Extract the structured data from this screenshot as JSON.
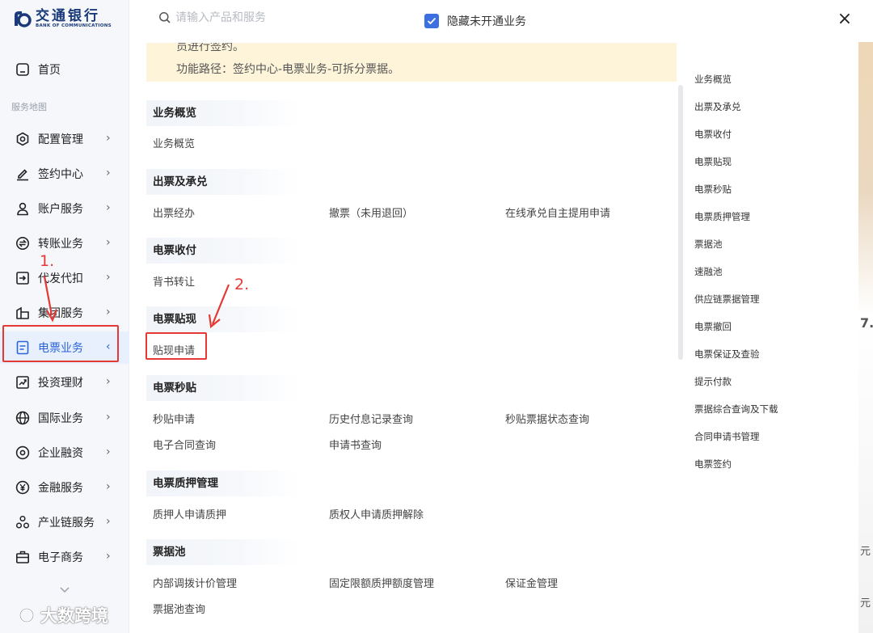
{
  "logo": {
    "cn": "交通银行",
    "en": "BANK OF COMMUNICATIONS"
  },
  "search": {
    "placeholder": "请输入产品和服务"
  },
  "hide_unopened": {
    "label": "隐藏未开通业务",
    "checked": true
  },
  "close_icon": "×",
  "sidebar": {
    "home": "首页",
    "section_label": "服务地图",
    "items": [
      {
        "label": "配置管理",
        "icon": "gear-icon"
      },
      {
        "label": "签约中心",
        "icon": "pen-icon"
      },
      {
        "label": "账户服务",
        "icon": "user-icon"
      },
      {
        "label": "转账业务",
        "icon": "transfer-icon"
      },
      {
        "label": "代发代扣",
        "icon": "export-icon"
      },
      {
        "label": "集团服务",
        "icon": "building-icon"
      },
      {
        "label": "电票业务",
        "icon": "bill-icon",
        "active": true
      },
      {
        "label": "投资理财",
        "icon": "chart-up-icon"
      },
      {
        "label": "国际业务",
        "icon": "globe-icon"
      },
      {
        "label": "企业融资",
        "icon": "target-icon"
      },
      {
        "label": "金融服务",
        "icon": "yen-icon"
      },
      {
        "label": "产业链服务",
        "icon": "nodes-icon"
      },
      {
        "label": "电子商务",
        "icon": "briefcase-icon"
      }
    ],
    "more_icon": "chevron-down-icon"
  },
  "notice": {
    "line1": "员进行签约。",
    "line2": "功能路径：签约中心-电票业务-可拆分票据。"
  },
  "sections": [
    {
      "title": "业务概览",
      "links": [
        "业务概览"
      ]
    },
    {
      "title": "出票及承兑",
      "links": [
        "出票经办",
        "撤票（未用退回）",
        "在线承兑自主提用申请"
      ]
    },
    {
      "title": "电票收付",
      "links": [
        "背书转让"
      ]
    },
    {
      "title": "电票贴现",
      "links": [
        "贴现申请"
      ]
    },
    {
      "title": "电票秒贴",
      "links": [
        "秒贴申请",
        "历史付息记录查询",
        "秒贴票据状态查询",
        "电子合同查询",
        "申请书查询"
      ]
    },
    {
      "title": "电票质押管理",
      "links": [
        "质押人申请质押",
        "质权人申请质押解除"
      ]
    },
    {
      "title": "票据池",
      "links": [
        "内部调拨计价管理",
        "固定限额质押额度管理",
        "保证金管理",
        "票据池查询"
      ]
    }
  ],
  "index": [
    "业务概览",
    "出票及承兑",
    "电票收付",
    "电票贴现",
    "电票秒贴",
    "电票质押管理",
    "票据池",
    "速融池",
    "供应链票据管理",
    "电票撤回",
    "电票保证及查验",
    "提示付款",
    "票据综合查询及下载",
    "合同申请书管理",
    "电票签约"
  ],
  "annotations": {
    "step1": "1.",
    "step2": "2."
  },
  "watermark": "大数跨境",
  "edge_chars": [
    "7.",
    "元",
    "元"
  ],
  "colors": {
    "accent": "#2b63d9",
    "annotation": "#e53935",
    "notice_bg": "#fdf4d9"
  }
}
